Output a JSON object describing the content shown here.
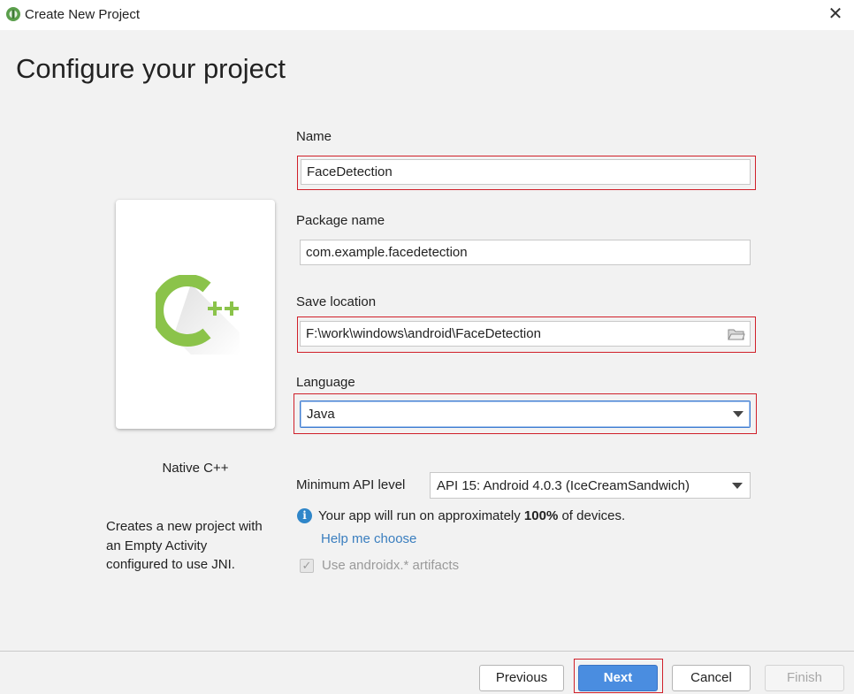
{
  "window": {
    "title": "Create New Project",
    "close_icon": "close-icon",
    "app_icon": "android-studio-icon"
  },
  "heading": "Configure your project",
  "template": {
    "name": "Native C++",
    "icon": "cpp-icon",
    "description_lines": [
      "Creates a new project with",
      "an Empty Activity",
      "configured to use JNI."
    ]
  },
  "form": {
    "name": {
      "label": "Name",
      "value": "FaceDetection"
    },
    "package_name": {
      "label": "Package name",
      "value": "com.example.facedetection"
    },
    "save_location": {
      "label": "Save location",
      "value": "F:\\work\\windows\\android\\FaceDetection",
      "icon": "folder-icon"
    },
    "language": {
      "label": "Language",
      "value": "Java"
    },
    "min_api": {
      "label": "Minimum API level",
      "value": "API 15: Android 4.0.3 (IceCreamSandwich)"
    },
    "info": {
      "prefix": "Your app will run on approximately ",
      "percent": "100%",
      "suffix": " of devices."
    },
    "help_link": "Help me choose",
    "androidx": {
      "label": "Use androidx.* artifacts",
      "checked": true,
      "enabled": false
    }
  },
  "buttons": {
    "previous": "Previous",
    "next": "Next",
    "cancel": "Cancel",
    "finish": "Finish"
  },
  "colors": {
    "highlight": "#d0202a",
    "accent": "#4a8de0",
    "link": "#3a7ebf",
    "cpp_green": "#8bc34a"
  }
}
